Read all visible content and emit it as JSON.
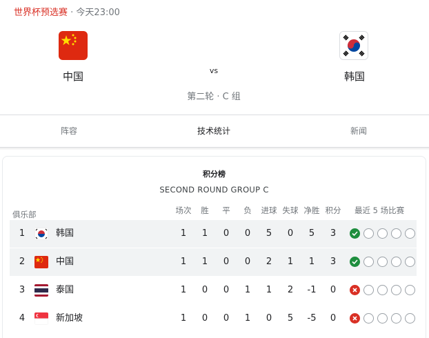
{
  "header": {
    "competition": "世界杯预选赛",
    "separator": " · ",
    "time": "今天23:00"
  },
  "match": {
    "home": {
      "name": "中国",
      "flag": "china-flag-icon"
    },
    "away": {
      "name": "韩国",
      "flag": "south-korea-flag-icon"
    },
    "vs": "vs",
    "round": "第二轮 · C 组"
  },
  "tabs": [
    {
      "label": "阵容",
      "active": false
    },
    {
      "label": "技术统计",
      "active": true
    },
    {
      "label": "新闻",
      "active": false
    }
  ],
  "standings": {
    "title": "积分榜",
    "subtitle": "SECOND ROUND GROUP C",
    "club_header": "俱乐部",
    "columns": [
      "场次",
      "胜",
      "平",
      "负",
      "进球",
      "失球",
      "净胜",
      "积分"
    ],
    "form_header": "最近 5 场比赛",
    "rows": [
      {
        "rank": "1",
        "team": "韩国",
        "flag": "south-korea-flag-icon",
        "stats": [
          "1",
          "1",
          "0",
          "0",
          "5",
          "0",
          "5",
          "3"
        ],
        "form": [
          "win",
          "none",
          "none",
          "none",
          "none"
        ]
      },
      {
        "rank": "2",
        "team": "中国",
        "flag": "china-flag-icon",
        "stats": [
          "1",
          "1",
          "0",
          "0",
          "2",
          "1",
          "1",
          "3"
        ],
        "form": [
          "win",
          "none",
          "none",
          "none",
          "none"
        ]
      },
      {
        "rank": "3",
        "team": "泰国",
        "flag": "thailand-flag-icon",
        "stats": [
          "1",
          "0",
          "0",
          "1",
          "1",
          "2",
          "-1",
          "0"
        ],
        "form": [
          "loss",
          "none",
          "none",
          "none",
          "none"
        ]
      },
      {
        "rank": "4",
        "team": "新加坡",
        "flag": "singapore-flag-icon",
        "stats": [
          "1",
          "0",
          "0",
          "1",
          "0",
          "5",
          "-5",
          "0"
        ],
        "form": [
          "loss",
          "none",
          "none",
          "none",
          "none"
        ]
      }
    ]
  },
  "colors": {
    "accent_red": "#d93025",
    "win_green": "#1e8e3e",
    "row_shade": "#f1f3f4"
  }
}
